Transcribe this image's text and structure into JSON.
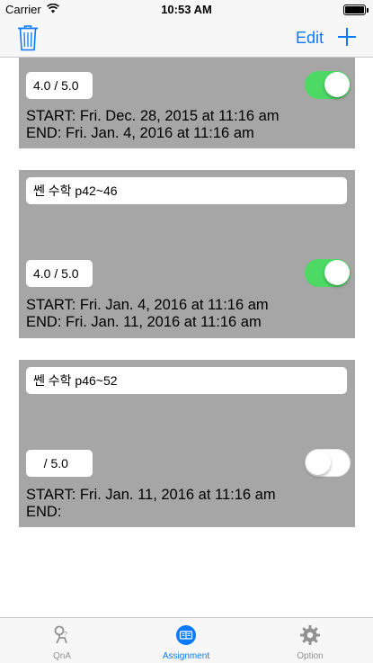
{
  "status_bar": {
    "carrier": "Carrier",
    "time": "10:53 AM"
  },
  "nav": {
    "edit_label": "Edit"
  },
  "cards": [
    {
      "title": "",
      "score": "4.0 / 5.0",
      "start": "START: Fri. Dec. 28, 2015 at 11:16 am",
      "end": "END: Fri. Jan. 4, 2016 at 11:16 am",
      "toggle_on": true
    },
    {
      "title": "쎈 수학 p42~46",
      "score": "4.0 / 5.0",
      "start": "START: Fri. Jan. 4, 2016 at 11:16 am",
      "end": "END: Fri. Jan. 11, 2016 at 11:16 am",
      "toggle_on": true
    },
    {
      "title": "쎈 수학 p46~52",
      "score": "   / 5.0",
      "start": "START: Fri. Jan. 11, 2016 at 11:16 am",
      "end": "END:",
      "toggle_on": false
    }
  ],
  "tabs": [
    {
      "label": "QnA",
      "icon": "qna-icon"
    },
    {
      "label": "Assignment",
      "icon": "assignment-icon"
    },
    {
      "label": "Option",
      "icon": "gear-icon"
    }
  ],
  "colors": {
    "accent": "#0a7aff",
    "card_bg": "#a6a6a6",
    "switch_on": "#4cd964",
    "tab_inactive": "#929292"
  }
}
